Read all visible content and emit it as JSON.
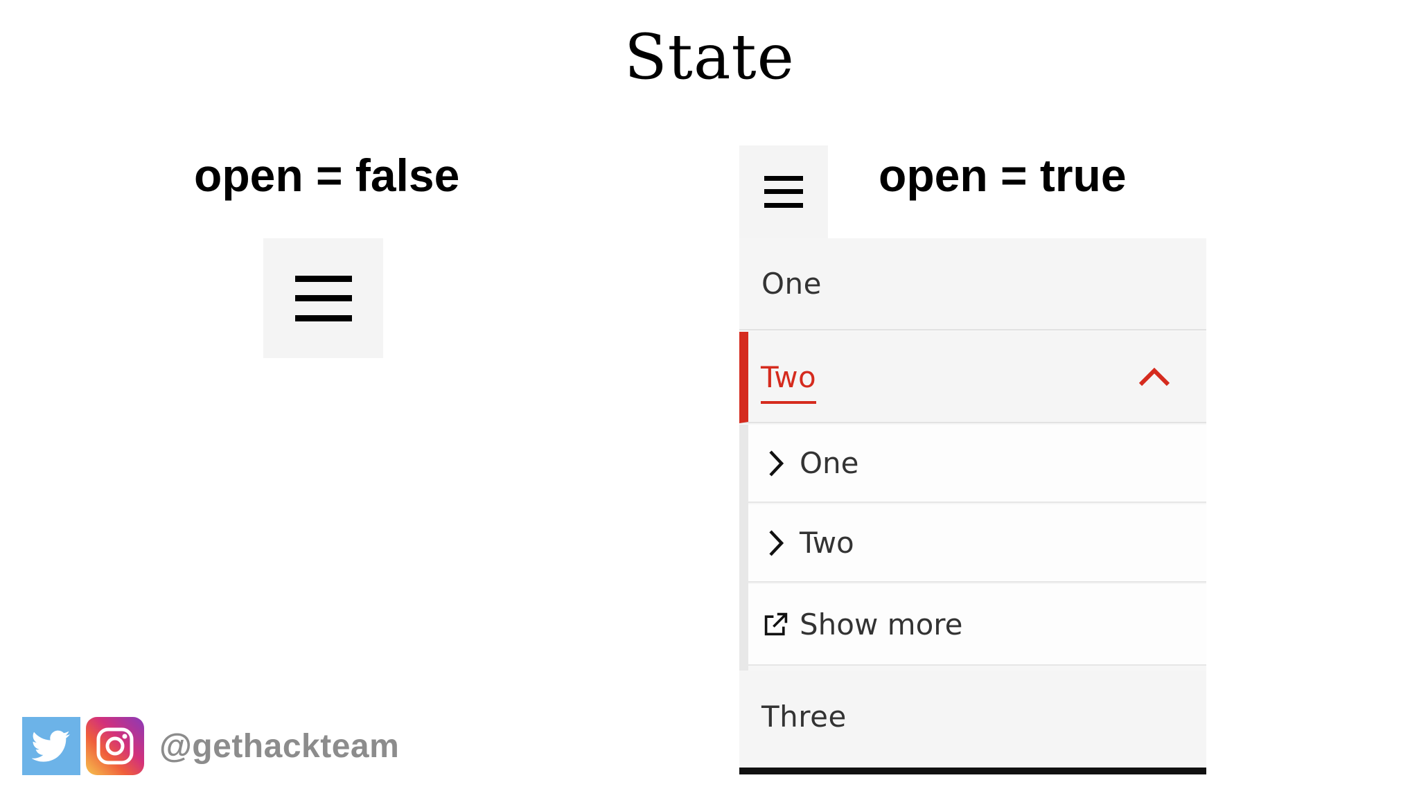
{
  "slide": {
    "title": "State"
  },
  "closed_state": {
    "label": "open = false",
    "menu_button_icon": "hamburger-icon"
  },
  "open_state": {
    "label": "open = true",
    "menu_button_icon": "hamburger-icon",
    "menu": {
      "items": [
        {
          "label": "One",
          "expanded": false
        },
        {
          "label": "Two",
          "expanded": true,
          "active": true,
          "icon": "chevron-up-icon",
          "children": [
            {
              "label": "One",
              "icon": "chevron-right-icon"
            },
            {
              "label": "Two",
              "icon": "chevron-right-icon"
            },
            {
              "label": "Show more",
              "icon": "external-link-icon"
            }
          ]
        },
        {
          "label": "Three",
          "expanded": false
        }
      ]
    }
  },
  "footer": {
    "handle": "@gethackteam",
    "icons": [
      "twitter-icon",
      "instagram-icon"
    ]
  },
  "colors": {
    "accent": "#d52b1e",
    "panel": "#f5f5f5",
    "handle_text": "#8c8c8c"
  }
}
